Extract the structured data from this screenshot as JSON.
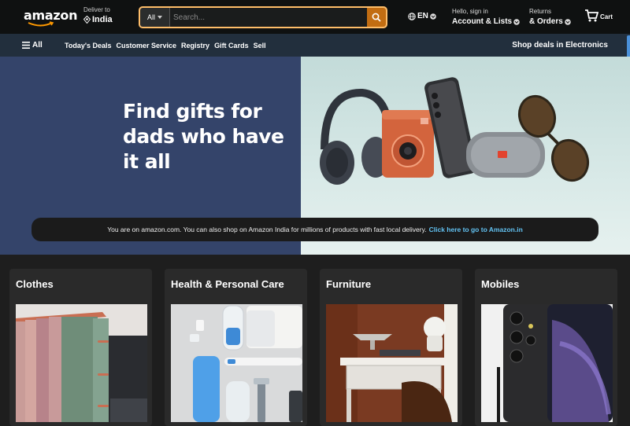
{
  "header": {
    "logo": "amazon",
    "deliver_label": "Deliver to",
    "deliver_location": "India",
    "search_category": "All",
    "search_placeholder": "Search...",
    "language": "EN",
    "account_line1": "Hello, sign in",
    "account_line2": "Account & Lists",
    "returns_line1": "Returns",
    "returns_line2": "& Orders",
    "cart_label": "Cart"
  },
  "nav": {
    "all_label": "All",
    "links": [
      "Today's Deals",
      "Customer Service",
      "Registry",
      "Gift Cards",
      "Sell"
    ],
    "promo": "Shop deals in Electronics"
  },
  "hero": {
    "title_line1": "Find gifts for",
    "title_line2": "dads who have it all",
    "notice_text": "You are on amazon.com. You can also shop on Amazon India for millions of products with fast local delivery.",
    "notice_link": "Click here to go to Amazon.in"
  },
  "cards": [
    {
      "title": "Clothes"
    },
    {
      "title": "Health & Personal Care"
    },
    {
      "title": "Furniture"
    },
    {
      "title": "Mobiles"
    }
  ],
  "colors": {
    "header_bg": "#0f1111",
    "nav_bg": "#222f3d",
    "search_border": "#febd69",
    "search_button": "#c26d12",
    "link_blue": "#62c2f2",
    "hero_left": "#34446a"
  }
}
